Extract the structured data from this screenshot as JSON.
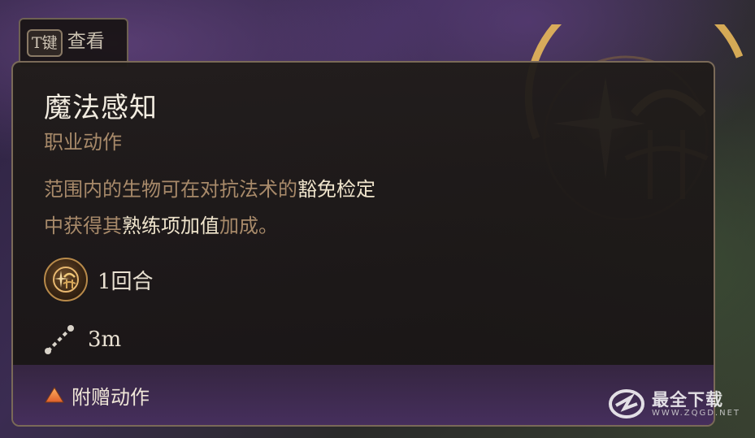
{
  "hotkey": {
    "key": "T键",
    "label": "查看"
  },
  "spell": {
    "title": "魔法感知",
    "type": "职业动作",
    "description": {
      "part1": "范围内的生物可在对抗法术的",
      "hl1": "豁免检定",
      "part2": "中获得其",
      "hl2": "熟练项加值",
      "part3": "加成。"
    },
    "cost": {
      "icon": "bonus-action-icon",
      "label": "1回合"
    },
    "range": {
      "icon": "range-icon",
      "label": "3m"
    },
    "action_type": {
      "icon": "triangle-icon",
      "label": "附赠动作"
    }
  },
  "watermark": {
    "name": "最全下载",
    "url": "WWW.ZQGD.NET"
  },
  "colors": {
    "accent_gold": "#d8a85a",
    "description_text": "#a88a6a",
    "highlight_text": "#efe4cc",
    "footer_purple": "#483060"
  }
}
